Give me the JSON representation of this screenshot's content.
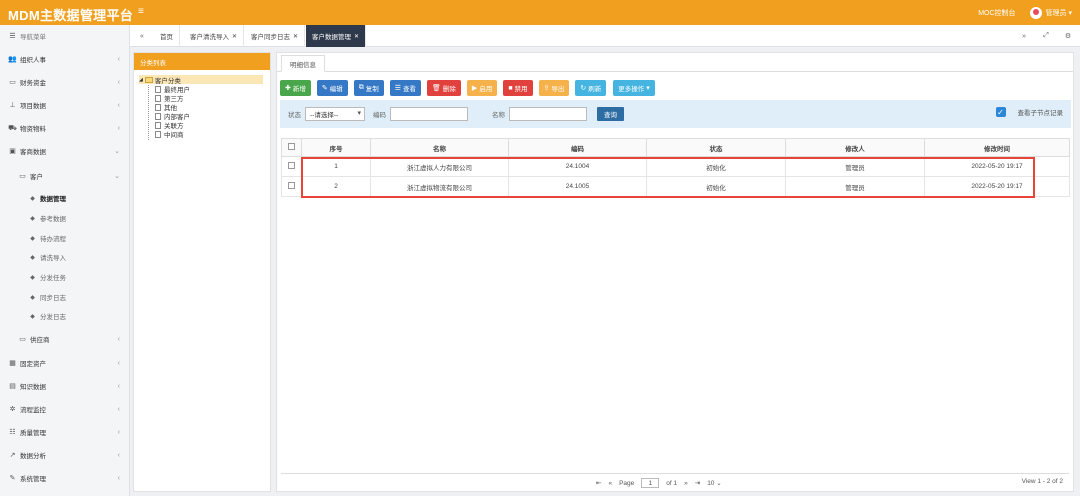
{
  "app": {
    "title": "MDM主数据管理平台",
    "menu_icon": "menu-icon",
    "console_link": "MOC控制台",
    "user": "管理员 ▾"
  },
  "sidebar": {
    "nav_title": "导航菜单",
    "items": [
      {
        "label": "组织人事"
      },
      {
        "label": "财务资金"
      },
      {
        "label": "项目数据"
      },
      {
        "label": "物资物料"
      },
      {
        "label": "客商数据"
      }
    ],
    "customer": "客户",
    "leaves": [
      "数据管理",
      "参考数据",
      "待办流程",
      "请洗导入",
      "分发任务",
      "同步日志",
      "分发日志"
    ],
    "supplier": "供应商",
    "bottom_items": [
      {
        "label": "固定资产"
      },
      {
        "label": "知识数据"
      },
      {
        "label": "流程监控"
      },
      {
        "label": "质量管理"
      },
      {
        "label": "数据分析"
      },
      {
        "label": "系统管理"
      }
    ]
  },
  "tabs": [
    {
      "label": "首页"
    },
    {
      "label": "客户清洗导入"
    },
    {
      "label": "客户同步日志"
    },
    {
      "label": "客户数据管理"
    }
  ],
  "tree": {
    "header": "分类列表",
    "root": "客户分类",
    "children": [
      "最终用户",
      "第三方",
      "其他",
      "内部客户",
      "关联方",
      "中间商"
    ]
  },
  "detail_tab": "明细信息",
  "toolbar": {
    "add": "新增",
    "edit": "编辑",
    "copy": "复制",
    "view": "查看",
    "delete": "删除",
    "enable": "启用",
    "disable": "禁用",
    "export": "导出",
    "refresh": "刷新",
    "more": "更多操作"
  },
  "search": {
    "status_label": "状态",
    "status_value": "--请选择--",
    "code_label": "编码",
    "name_label": "名称",
    "query": "查询",
    "include_children": "查看子节点记录"
  },
  "table": {
    "headers": [
      "序号",
      "名称",
      "编码",
      "状态",
      "修改人",
      "修改时间"
    ],
    "rows": [
      [
        "1",
        "浙江虚拟人力有限公司",
        "24.1004",
        "初始化",
        "管理员",
        "2022-05-20 19:17"
      ],
      [
        "2",
        "浙江虚拟物流有限公司",
        "24.1005",
        "初始化",
        "管理员",
        "2022-05-20 19:17"
      ]
    ]
  },
  "pager": {
    "page_label": "Page",
    "page_value": "1",
    "of_label": "of 1",
    "page_size": "10",
    "view_text": "View 1 - 2 of 2"
  },
  "colors": {
    "brand": "#f0a01e",
    "dark_tab": "#2e3a4b",
    "highlight": "#e8443a"
  }
}
